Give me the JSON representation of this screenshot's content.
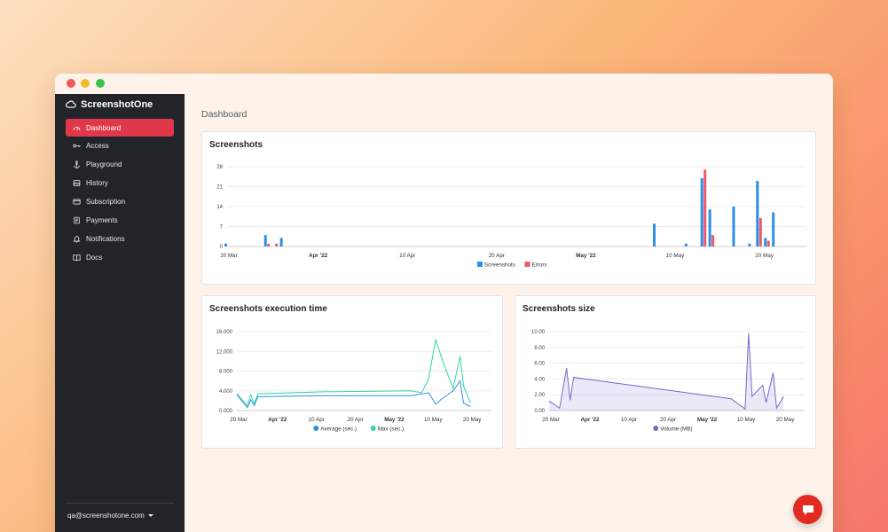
{
  "app": {
    "brand": "ScreenshotOne",
    "page_title": "Dashboard"
  },
  "sidebar": {
    "items": [
      {
        "label": "Dashboard",
        "icon": "gauge-icon",
        "active": true
      },
      {
        "label": "Access",
        "icon": "key-icon",
        "active": false
      },
      {
        "label": "Playground",
        "icon": "anchor-icon",
        "active": false
      },
      {
        "label": "History",
        "icon": "image-icon",
        "active": false
      },
      {
        "label": "Subscription",
        "icon": "card-icon",
        "active": false
      },
      {
        "label": "Payments",
        "icon": "receipt-icon",
        "active": false
      },
      {
        "label": "Notifications",
        "icon": "bell-icon",
        "active": false
      },
      {
        "label": "Docs",
        "icon": "book-icon",
        "active": false
      }
    ],
    "user_email": "qa@screenshotone.com"
  },
  "colors": {
    "accent": "#e0384a",
    "sidebar_bg": "#212428",
    "screenshots": "#2e8ee6",
    "errors": "#f05a6b",
    "average": "#2e8ee6",
    "max": "#2fd6a2",
    "volume": "#7b68cc",
    "chat": "#e02a22"
  },
  "chart_data": [
    {
      "id": "screenshots",
      "type": "bar",
      "title": "Screenshots",
      "x_ticks": [
        "20 Mar",
        "Apr '22",
        "10 Apr",
        "20 Apr",
        "May '22",
        "10 May",
        "20 May"
      ],
      "x_range": [
        0,
        73
      ],
      "ylim": [
        0,
        28
      ],
      "y_ticks": [
        "0",
        "7",
        "14",
        "21",
        "28"
      ],
      "legend": "bottom",
      "series": [
        {
          "name": "Screenshots",
          "points": [
            [
              0,
              1
            ],
            [
              5,
              4
            ],
            [
              7,
              3
            ],
            [
              54,
              8
            ],
            [
              58,
              1
            ],
            [
              60,
              24
            ],
            [
              61,
              13
            ],
            [
              64,
              14
            ],
            [
              66,
              1
            ],
            [
              67,
              23
            ],
            [
              68,
              3
            ],
            [
              69,
              12
            ]
          ]
        },
        {
          "name": "Errors",
          "points": [
            [
              5,
              1
            ],
            [
              6,
              1
            ],
            [
              60,
              27
            ],
            [
              61,
              4
            ],
            [
              67,
              10
            ],
            [
              68,
              2
            ]
          ]
        }
      ]
    },
    {
      "id": "execution",
      "type": "line",
      "title": "Screenshots execution time",
      "x_ticks": [
        "20 Mar",
        "Apr '22",
        "10 Apr",
        "20 Apr",
        "May '22",
        "10 May",
        "20 May"
      ],
      "x_range": [
        0,
        73
      ],
      "ylim": [
        0,
        16000
      ],
      "y_ticks": [
        "0.000",
        "4.000",
        "8.000",
        "12.000",
        "16.000"
      ],
      "legend": "bottom",
      "series": [
        {
          "name": "Average (sec.)",
          "points": [
            [
              0,
              3200
            ],
            [
              3,
              600
            ],
            [
              4,
              2200
            ],
            [
              5,
              1000
            ],
            [
              6,
              2800
            ],
            [
              25,
              3000
            ],
            [
              50,
              3000
            ],
            [
              55,
              3600
            ],
            [
              57,
              1300
            ],
            [
              59,
              2500
            ],
            [
              62,
              4000
            ],
            [
              64,
              6000
            ],
            [
              65,
              1500
            ],
            [
              67,
              800
            ]
          ]
        },
        {
          "name": "Max (sec.)",
          "points": [
            [
              0,
              3400
            ],
            [
              3,
              1000
            ],
            [
              4,
              3200
            ],
            [
              5,
              1400
            ],
            [
              6,
              3400
            ],
            [
              25,
              3800
            ],
            [
              50,
              4000
            ],
            [
              53,
              3600
            ],
            [
              55,
              6500
            ],
            [
              57,
              14400
            ],
            [
              59,
              10000
            ],
            [
              62,
              4500
            ],
            [
              64,
              11000
            ],
            [
              65,
              5000
            ],
            [
              67,
              1500
            ]
          ]
        }
      ]
    },
    {
      "id": "size",
      "type": "area",
      "title": "Screenshots size",
      "x_ticks": [
        "20 Mar",
        "Apr '22",
        "10 Apr",
        "20 Apr",
        "May '22",
        "10 May",
        "20 May"
      ],
      "x_range": [
        0,
        73
      ],
      "ylim": [
        0,
        10
      ],
      "y_ticks": [
        "0.00",
        "2.00",
        "4.00",
        "6.00",
        "8.00",
        "10.00"
      ],
      "legend": "bottom",
      "series": [
        {
          "name": "Volume (MB)",
          "points": [
            [
              0,
              1.2
            ],
            [
              3,
              0.3
            ],
            [
              5,
              5.4
            ],
            [
              6,
              1.3
            ],
            [
              7,
              4.2
            ],
            [
              52,
              1.5
            ],
            [
              56,
              0.2
            ],
            [
              57,
              9.8
            ],
            [
              58,
              1.8
            ],
            [
              61,
              3.2
            ],
            [
              62,
              1.0
            ],
            [
              64,
              4.8
            ],
            [
              65,
              0.3
            ],
            [
              67,
              1.8
            ]
          ]
        }
      ]
    }
  ]
}
